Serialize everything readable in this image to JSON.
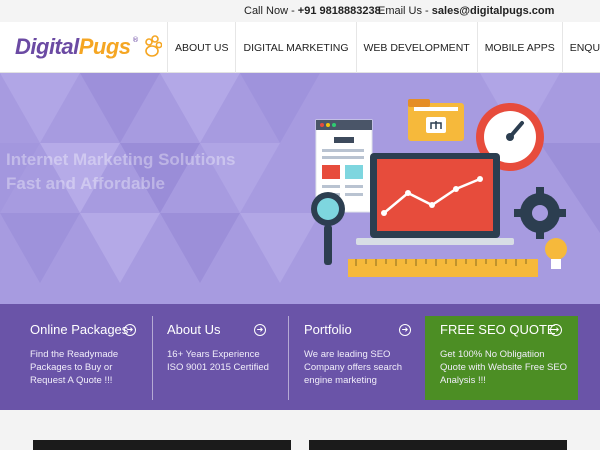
{
  "topbar": {
    "call_label": "Call Now - ",
    "call_number": "+91 9818883238",
    "email_label": "Email Us - ",
    "email_value": "sales@digitalpugs.com"
  },
  "brand": {
    "name_part1": "Digital",
    "name_part2": "Pugs",
    "registered_mark": "®",
    "primary_color": "#6b4aa3",
    "accent_color": "#f5a623"
  },
  "nav": {
    "items": [
      {
        "label": "About Us"
      },
      {
        "label": "Digital Marketing"
      },
      {
        "label": "Web Development"
      },
      {
        "label": "Mobile Apps"
      },
      {
        "label": "Enquiry"
      }
    ]
  },
  "hero": {
    "title_line1": "Internet Marketing Solutions",
    "title_line2": "Fast and Affordable",
    "background_color": "#a79be0"
  },
  "features": [
    {
      "title": "Online Packages",
      "desc_lines": [
        "Find the Readymade",
        "Packages to Buy or",
        "Request A Quote !!!"
      ],
      "icon": "circle-arrow-right-icon"
    },
    {
      "title": "About Us",
      "desc_lines": [
        "16+ Years Experience",
        "ISO 9001 2015 Certified"
      ],
      "icon": "circle-arrow-right-icon"
    },
    {
      "title": "Portfolio",
      "desc_lines": [
        "We are leading SEO",
        "Company offers search",
        "engine marketing"
      ],
      "icon": "circle-arrow-right-icon"
    },
    {
      "title": "FREE SEO QUOTE",
      "desc_lines": [
        "Get 100% No Obligatiion",
        "Quote with Website Free SEO",
        "Analysis !!!"
      ],
      "icon": "circle-arrow-right-icon",
      "highlight_color": "#4c8e24"
    }
  ],
  "colors": {
    "band": "#6a54a8",
    "quote_box": "#4c8e24"
  }
}
